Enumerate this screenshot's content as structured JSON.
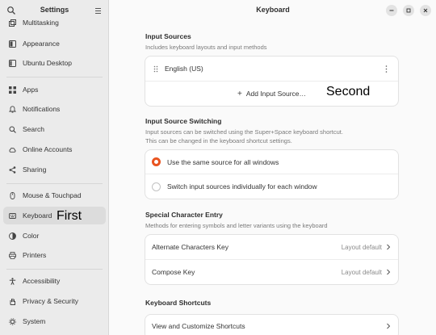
{
  "sidebar": {
    "title": "Settings",
    "items": [
      {
        "label": "Multitasking",
        "icon": "multitasking-icon"
      },
      {
        "label": "Appearance",
        "icon": "appearance-icon"
      },
      {
        "label": "Ubuntu Desktop",
        "icon": "ubuntu-desktop-icon"
      },
      {
        "label": "Apps",
        "icon": "apps-icon"
      },
      {
        "label": "Notifications",
        "icon": "bell-icon"
      },
      {
        "label": "Search",
        "icon": "search-icon"
      },
      {
        "label": "Online Accounts",
        "icon": "cloud-icon"
      },
      {
        "label": "Sharing",
        "icon": "share-icon"
      },
      {
        "label": "Mouse & Touchpad",
        "icon": "mouse-icon"
      },
      {
        "label": "Keyboard",
        "icon": "keyboard-icon"
      },
      {
        "label": "Color",
        "icon": "color-icon"
      },
      {
        "label": "Printers",
        "icon": "printer-icon"
      },
      {
        "label": "Accessibility",
        "icon": "accessibility-icon"
      },
      {
        "label": "Privacy & Security",
        "icon": "hand-icon"
      },
      {
        "label": "System",
        "icon": "system-icon"
      }
    ],
    "active": "Keyboard"
  },
  "header": {
    "title": "Keyboard"
  },
  "input_sources": {
    "title": "Input Sources",
    "description": "Includes keyboard layouts and input methods",
    "source": "English (US)",
    "add_label": "Add Input Source…"
  },
  "switching": {
    "title": "Input Source Switching",
    "description_1": "Input sources can be switched using the Super+Space keyboard shortcut.",
    "description_2": "This can be changed in the keyboard shortcut settings.",
    "option_same": "Use the same source for all windows",
    "option_each": "Switch input sources individually for each window",
    "selected": "option_same"
  },
  "special_chars": {
    "title": "Special Character Entry",
    "description": "Methods for entering symbols and letter variants using the keyboard",
    "alternate_label": "Alternate Characters Key",
    "alternate_value": "Layout default",
    "compose_label": "Compose Key",
    "compose_value": "Layout default"
  },
  "shortcuts": {
    "title": "Keyboard Shortcuts",
    "view_label": "View and Customize Shortcuts"
  },
  "annotations": {
    "first": "First",
    "second": "Second"
  },
  "colors": {
    "accent": "#e95420",
    "sidebar_bg": "#ebebeb",
    "content_bg": "#fafafa"
  }
}
